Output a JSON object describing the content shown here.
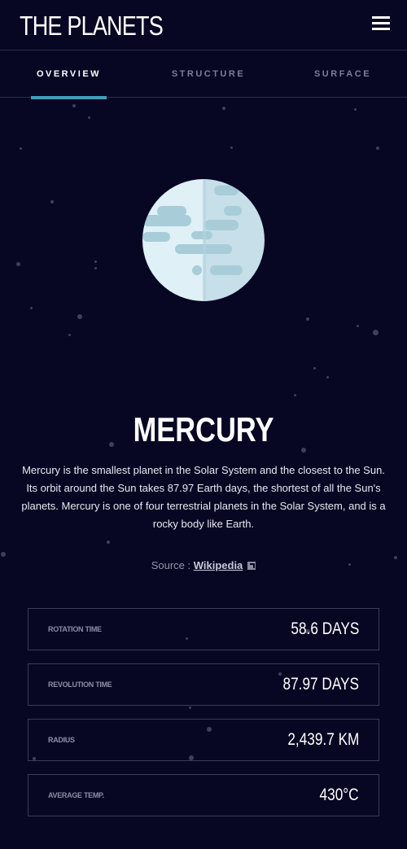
{
  "header": {
    "logo": "THE PLANETS",
    "menu_icon": "hamburger-menu-icon"
  },
  "tabs": [
    {
      "label": "OVERVIEW",
      "active": true
    },
    {
      "label": "STRUCTURE",
      "active": false
    },
    {
      "label": "SURFACE",
      "active": false
    }
  ],
  "planet": {
    "name": "MERCURY",
    "description": "Mercury is the smallest planet in the Solar System and the closest to the Sun. Its orbit around the Sun takes 87.97 Earth days, the shortest of all the Sun's planets. Mercury is one of four terrestrial planets in the Solar System, and is a rocky body like Earth.",
    "source_label": "Source : ",
    "source_link": "Wikipedia",
    "source_icon": "external-link-icon"
  },
  "stats": [
    {
      "label": "ROTATION TIME",
      "value": "58.6 DAYS"
    },
    {
      "label": "REVOLUTION TIME",
      "value": "87.97 DAYS"
    },
    {
      "label": "RADIUS",
      "value": "2,439.7 KM"
    },
    {
      "label": "AVERAGE TEMP.",
      "value": "430°C"
    }
  ],
  "colors": {
    "background": "#070724",
    "accent": "#419ebb",
    "border": "#3b3c55"
  }
}
